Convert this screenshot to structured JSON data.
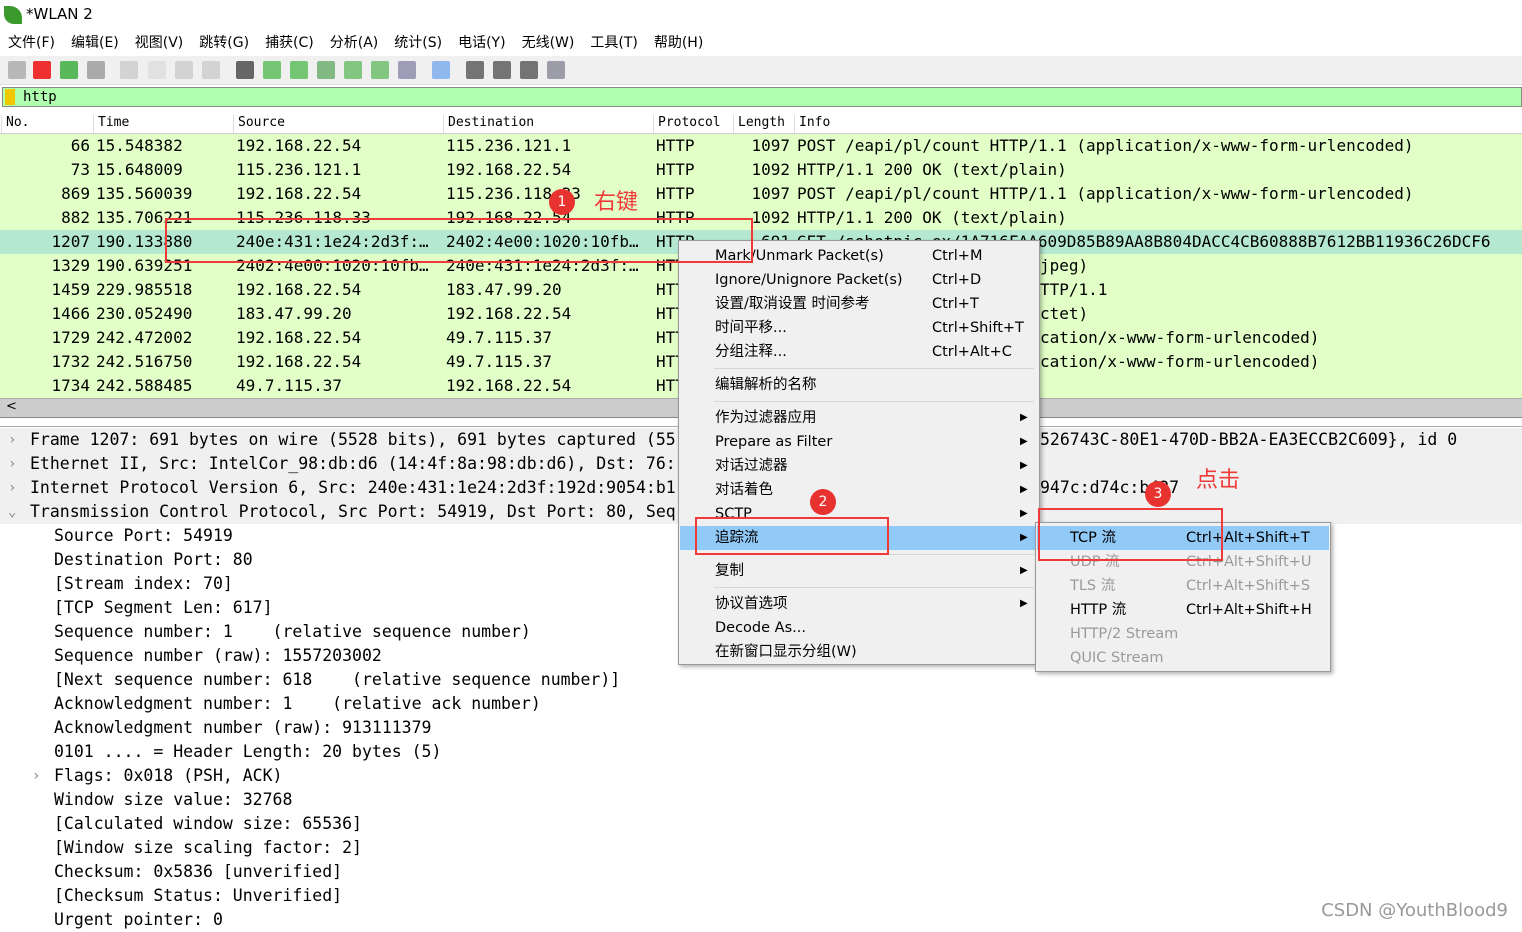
{
  "window": {
    "title": "*WLAN 2"
  },
  "menubar": [
    "文件(F)",
    "编辑(E)",
    "视图(V)",
    "跳转(G)",
    "捕获(C)",
    "分析(A)",
    "统计(S)",
    "电话(Y)",
    "无线(W)",
    "工具(T)",
    "帮助(H)"
  ],
  "toolbar": [
    "shark-fin-icon",
    "stop-icon",
    "restart-icon",
    "options-gear-icon",
    "open-icon",
    "file-icon",
    "close-file-icon",
    "reload-icon",
    "find-icon",
    "back-arrow-icon",
    "forward-arrow-icon",
    "goto-packet-icon",
    "first-packet-icon",
    "last-packet-icon",
    "autoscroll-icon",
    "colorize-icon",
    "zoom-in-icon",
    "zoom-out-icon",
    "zoom-normal-icon",
    "resize-columns-icon"
  ],
  "filter": {
    "value": "http",
    "bg": "#afffaf"
  },
  "columns": [
    "No.",
    "Time",
    "Source",
    "Destination",
    "Protocol",
    "Length",
    "Info"
  ],
  "packets": [
    {
      "no": "66",
      "time": "15.548382",
      "src": "192.168.22.54",
      "dst": "115.236.121.1",
      "proto": "HTTP",
      "len": "1097",
      "info": "POST /eapi/pl/count HTTP/1.1  (application/x-www-form-urlencoded)"
    },
    {
      "no": "73",
      "time": "15.648009",
      "src": "115.236.121.1",
      "dst": "192.168.22.54",
      "proto": "HTTP",
      "len": "1092",
      "info": "HTTP/1.1 200 OK  (text/plain)"
    },
    {
      "no": "869",
      "time": "135.560039",
      "src": "192.168.22.54",
      "dst": "115.236.118.33",
      "proto": "HTTP",
      "len": "1097",
      "info": "POST /eapi/pl/count HTTP/1.1  (application/x-www-form-urlencoded)"
    },
    {
      "no": "882",
      "time": "135.706221",
      "src": "115.236.118.33",
      "dst": "192.168.22.54",
      "proto": "HTTP",
      "len": "1092",
      "info": "HTTP/1.1 200 OK  (text/plain)"
    },
    {
      "no": "1207",
      "time": "190.133880",
      "src": "240e:431:1e24:2d3f:…",
      "dst": "2402:4e00:1020:10fb…",
      "proto": "HTTP",
      "len": "691",
      "info": "GET /sohotnic.ex/1A716FAA609D85B89AA8B804DACC4CB60888B7612BB11936C26DCF6",
      "selected": true
    },
    {
      "no": "1329",
      "time": "190.639251",
      "src": "2402:4e00:1020:10fb…",
      "dst": "240e:431:1e24:2d3f:…",
      "proto": "HTTP",
      "info_visible": "jpeg)"
    },
    {
      "no": "1459",
      "time": "229.985518",
      "src": "192.168.22.54",
      "dst": "183.47.99.20",
      "proto": "HTTP",
      "info_visible": "TTP/1.1"
    },
    {
      "no": "1466",
      "time": "230.052490",
      "src": "183.47.99.20",
      "dst": "192.168.22.54",
      "proto": "HTTP",
      "info_visible": "ctet)"
    },
    {
      "no": "1729",
      "time": "242.472002",
      "src": "192.168.22.54",
      "dst": "49.7.115.37",
      "proto": "HTTP",
      "info_visible": "cation/x-www-form-urlencoded)"
    },
    {
      "no": "1732",
      "time": "242.516750",
      "src": "192.168.22.54",
      "dst": "49.7.115.37",
      "proto": "HTTP",
      "info_visible": "cation/x-www-form-urlencoded)"
    },
    {
      "no": "1734",
      "time": "242.588485",
      "src": "49.7.115.37",
      "dst": "192.168.22.54",
      "proto": "HTTP"
    }
  ],
  "details": [
    {
      "text": "Frame 1207: 691 bytes on wire (5528 bits), 691 bytes captured (55",
      "tail": "526743C-80E1-470D-BB2A-EA3ECCB2C609}, id 0",
      "exp": ">",
      "top": true
    },
    {
      "text": "Ethernet II, Src: IntelCor_98:db:d6 (14:4f:8a:98:db:d6), Dst: 76:",
      "exp": ">",
      "top": true
    },
    {
      "text": "Internet Protocol Version 6, Src: 240e:431:1e24:2d3f:192d:9054:b1",
      "tail": "947c:d74c:b427",
      "exp": ">",
      "top": true
    },
    {
      "text": "Transmission Control Protocol, Src Port: 54919, Dst Port: 80, Seq",
      "exp": "v",
      "top": true
    },
    {
      "text": "Source Port: 54919"
    },
    {
      "text": "Destination Port: 80"
    },
    {
      "text": "[Stream index: 70]"
    },
    {
      "text": "[TCP Segment Len: 617]"
    },
    {
      "text": "Sequence number: 1    (relative sequence number)"
    },
    {
      "text": "Sequence number (raw): 1557203002"
    },
    {
      "text": "[Next sequence number: 618    (relative sequence number)]"
    },
    {
      "text": "Acknowledgment number: 1    (relative ack number)"
    },
    {
      "text": "Acknowledgment number (raw): 913111379"
    },
    {
      "text": "0101 .... = Header Length: 20 bytes (5)"
    },
    {
      "text": "Flags: 0x018 (PSH, ACK)",
      "exp": ">"
    },
    {
      "text": "Window size value: 32768"
    },
    {
      "text": "[Calculated window size: 65536]"
    },
    {
      "text": "[Window size scaling factor: 2]"
    },
    {
      "text": "Checksum: 0x5836 [unverified]"
    },
    {
      "text": "[Checksum Status: Unverified]"
    },
    {
      "text": "Urgent pointer: 0"
    }
  ],
  "context_menu": [
    {
      "label": "Mark/Unmark Packet(s)",
      "shortcut": "Ctrl+M"
    },
    {
      "label": "Ignore/Unignore Packet(s)",
      "shortcut": "Ctrl+D"
    },
    {
      "label": "设置/取消设置 时间参考",
      "shortcut": "Ctrl+T"
    },
    {
      "label": "时间平移...",
      "shortcut": "Ctrl+Shift+T"
    },
    {
      "label": "分组注释...",
      "shortcut": "Ctrl+Alt+C"
    },
    {
      "sep": true
    },
    {
      "label": "编辑解析的名称"
    },
    {
      "sep": true
    },
    {
      "label": "作为过滤器应用",
      "submenu": true
    },
    {
      "label": "Prepare as Filter",
      "submenu": true
    },
    {
      "label": "对话过滤器",
      "submenu": true
    },
    {
      "label": "对话着色",
      "submenu": true
    },
    {
      "label": "SCTP",
      "submenu": true
    },
    {
      "label": "追踪流",
      "submenu": true,
      "highlighted": true
    },
    {
      "sep": true
    },
    {
      "label": "复制",
      "submenu": true
    },
    {
      "sep": true
    },
    {
      "label": "协议首选项",
      "submenu": true
    },
    {
      "label": "Decode As..."
    },
    {
      "label": "在新窗口显示分组(W)"
    }
  ],
  "submenu": [
    {
      "label": "TCP 流",
      "shortcut": "Ctrl+Alt+Shift+T",
      "highlighted": true
    },
    {
      "label": "UDP 流",
      "shortcut": "Ctrl+Alt+Shift+U",
      "disabled": true
    },
    {
      "label": "TLS 流",
      "shortcut": "Ctrl+Alt+Shift+S",
      "disabled": true
    },
    {
      "label": "HTTP 流",
      "shortcut": "Ctrl+Alt+Shift+H"
    },
    {
      "label": "HTTP/2 Stream",
      "disabled": true
    },
    {
      "label": "QUIC Stream",
      "disabled": true
    }
  ],
  "annotations": {
    "step1": "1",
    "step1_label": "右键",
    "step2": "2",
    "step3": "3",
    "step3_label": "点击",
    "color": "#f03a3a"
  },
  "watermark": "CSDN @YouthBlood9"
}
